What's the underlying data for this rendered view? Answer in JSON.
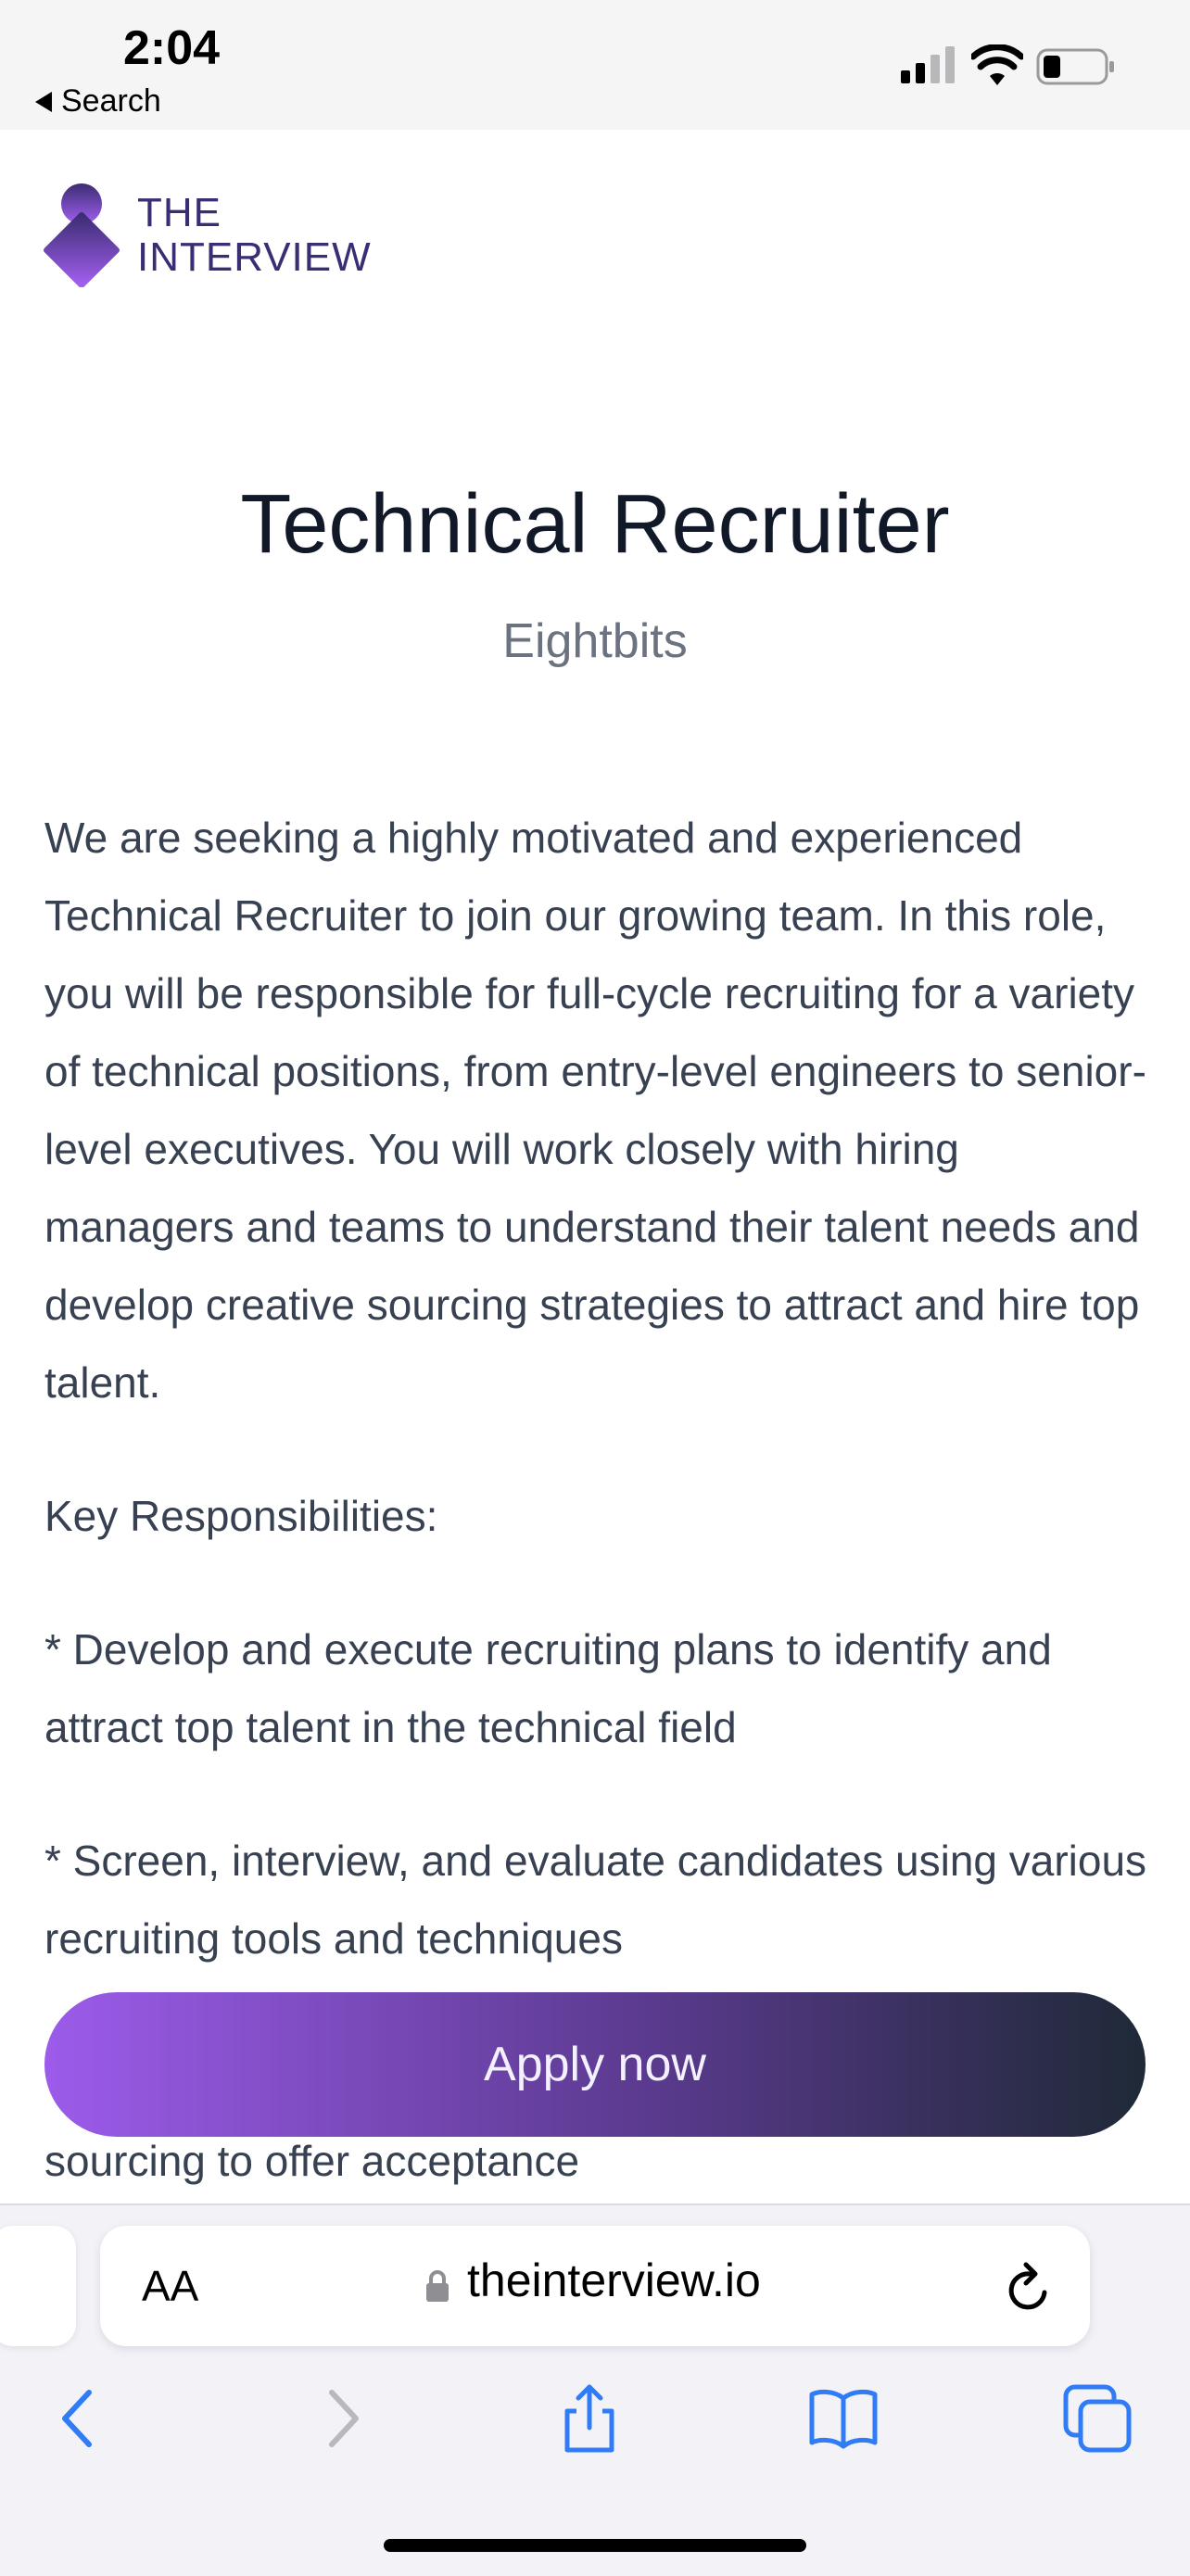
{
  "status_bar": {
    "time": "2:04",
    "back_label": "Search"
  },
  "brand": {
    "line1": "THE",
    "line2": "INTERVIEW"
  },
  "job": {
    "title": "Technical Recruiter",
    "company": "Eightbits"
  },
  "description": {
    "intro": "We are seeking a highly motivated and experienced Technical Recruiter to join our growing team. In this role, you will be responsible for full-cycle recruiting for a variety of technical positions, from entry-level engineers to senior-level executives. You will work closely with hiring managers and teams to understand their talent needs and develop creative sourcing strategies to attract and hire top talent.",
    "heading": "Key Responsibilities:",
    "bullets": [
      "* Develop and execute recruiting plans to identify and attract top talent in the technical field",
      "* Screen, interview, and evaluate candidates using various recruiting tools and techniques"
    ],
    "partial": "sourcing to offer acceptance"
  },
  "apply_button": {
    "label": "Apply now"
  },
  "browser": {
    "text_size_label": "AA",
    "url": "theinterview.io"
  },
  "colors": {
    "brand_purple": "#3b2d73",
    "button_start": "#9c5bea",
    "button_end": "#1f2937",
    "ios_blue": "#2f7cf6"
  },
  "icons": {
    "toolbar": [
      "back-icon",
      "forward-icon",
      "share-icon",
      "bookmarks-icon",
      "tabs-icon"
    ]
  }
}
